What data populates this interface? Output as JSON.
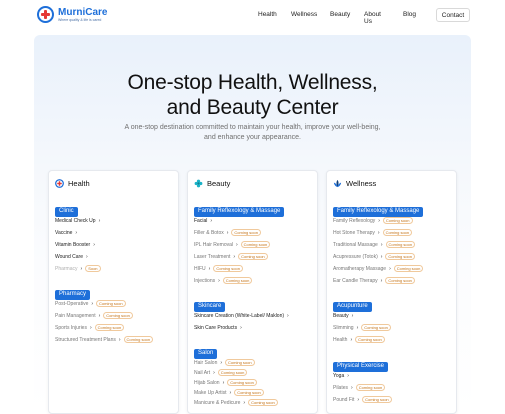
{
  "brand": {
    "name": "MurniCare",
    "tagline": "Where quality & life is cared"
  },
  "nav": {
    "items": [
      "Health",
      "Wellness",
      "Beauty",
      "About Us",
      "Blog"
    ],
    "contact": "Contact"
  },
  "hero": {
    "title_line1": "One-stop Health, Wellness,",
    "title_line2": "and Beauty Center",
    "subtitle": "A one-stop destination committed to maintain your health, improve your well-being, and enhance your appearance."
  },
  "soon_label": "Coming soon",
  "soon_label_short": "Soon",
  "cards": {
    "health": {
      "title": "Health",
      "clinic": {
        "label": "Clinic",
        "items": [
          "Medical Check Up",
          "Vaccine",
          "Vitamin Booster",
          "Wound Care",
          "Pharmacy"
        ]
      },
      "pharmacy": {
        "label": "Pharmacy",
        "items": [
          "Post-Operative",
          "Pain Management",
          "Sports Injuries",
          "Structured Treatment Plans"
        ]
      }
    },
    "beauty": {
      "title": "Beauty",
      "family": {
        "label": "Family Reflexology & Massage",
        "items": [
          "Facial",
          "Filler & Botox",
          "IPL Hair Removal",
          "Laser Treatment",
          "HIFU",
          "Injections"
        ]
      },
      "skincare": {
        "label": "Skincare",
        "items": [
          "Skincare Creation (White-Label/ Maklon)",
          "Skin Care Products"
        ]
      },
      "salon": {
        "label": "Salon",
        "items": [
          "Hair Salon",
          "Nail Art",
          "Hijab Salon",
          "Make Up Artist",
          "Manicure & Pedicure"
        ]
      }
    },
    "wellness": {
      "title": "Wellness",
      "family": {
        "label": "Family Reflexology & Massage",
        "items": [
          "Family Reflexology",
          "Hot Stone Therapy",
          "Traditional Massage",
          "Acupressure (Totok)",
          "Aromatherapy Massage",
          "Ear Candle Therapy"
        ]
      },
      "acupuncture": {
        "label": "Acupunture",
        "items": [
          "Beauty",
          "Slimming",
          "Health"
        ]
      },
      "exercise": {
        "label": "Physical Exercise",
        "items": [
          "Yoga",
          "Pilates",
          "Pound Fit"
        ]
      }
    }
  }
}
